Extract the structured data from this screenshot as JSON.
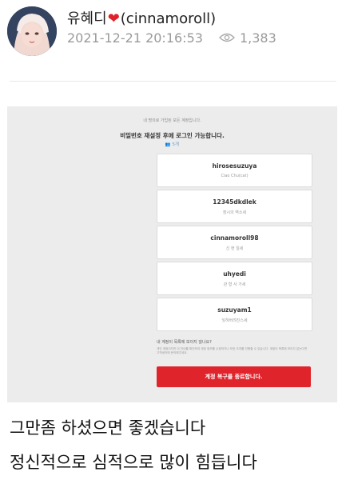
{
  "post": {
    "author_name": "유혜디",
    "author_handle": "(cinnamoroll)",
    "heart_icon": "heart-icon",
    "date": "2021-12-21 20:16:53",
    "views": "1,383"
  },
  "screenshot": {
    "notice": "내 명의로 가입된 모든 계정입니다.",
    "headline": "비밀번호 재설정 후에 로그인 가능합니다.",
    "count": "5개",
    "accounts": [
      {
        "id": "hirosesuzuya",
        "sub": "Ciao Chu(cat)"
      },
      {
        "id": "12345dkdlek",
        "sub": "장시의 역소세"
      },
      {
        "id": "cinnamoroll98",
        "sub": "신 현 일세"
      },
      {
        "id": "uhyedi",
        "sub": "관 형 사 가세"
      },
      {
        "id": "suzuyam1",
        "sub": "잊혀버려진스세"
      }
    ],
    "question": "내 계정이 목록에 보이지 않나요?",
    "fine_print": "개인 계정이지만 이 안내를 확인하여 계정 정보를 수정하거나 보호 조치를 진행할 수 있습니다. 계정이 목록에 보이지 않는다면 고객센터에 문의해주세요.",
    "restore_button": "계정 복구를 종료합니다."
  },
  "caption": {
    "line1": "그만좀 하셨으면 좋겠습니다",
    "line2": "정신적으로 심적으로 많이 힘듭니다"
  },
  "colors": {
    "accent_red": "#e0242c",
    "heart_red": "#e0212a",
    "meta_gray": "#9a9a9a"
  }
}
